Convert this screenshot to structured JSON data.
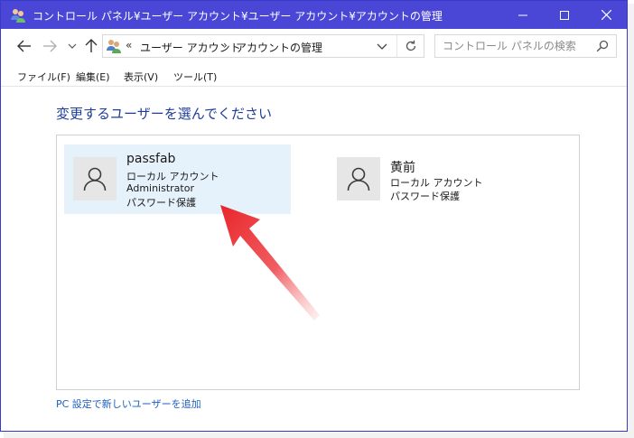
{
  "window": {
    "title": "コントロール パネル¥ユーザー アカウント¥ユーザー アカウント¥アカウントの管理",
    "titlebar_color": "#4a46d6"
  },
  "address_bar": {
    "overflow": "«",
    "crumbs": [
      "ユーザー アカウント",
      "アカウントの管理"
    ],
    "separator": "›"
  },
  "search": {
    "placeholder": "コントロール パネルの検索"
  },
  "menu": {
    "items": [
      "ファイル(F)",
      "編集(E)",
      "表示(V)",
      "ツール(T)"
    ]
  },
  "main": {
    "heading": "変更するユーザーを選んでください",
    "users": [
      {
        "name": "passfab",
        "lines": [
          "ローカル アカウント",
          "Administrator",
          "パスワード保護"
        ],
        "selected": true
      },
      {
        "name": "黄前",
        "lines": [
          "ローカル アカウント",
          "パスワード保護"
        ],
        "selected": false
      }
    ],
    "add_user_link": "PC 設定で新しいユーザーを追加"
  },
  "colors": {
    "accent": "#4a46d6",
    "heading": "#1f3d99",
    "link": "#1d5fbf",
    "selected_tile": "#e5f1fb",
    "annotation_arrow": "#e8262b"
  }
}
